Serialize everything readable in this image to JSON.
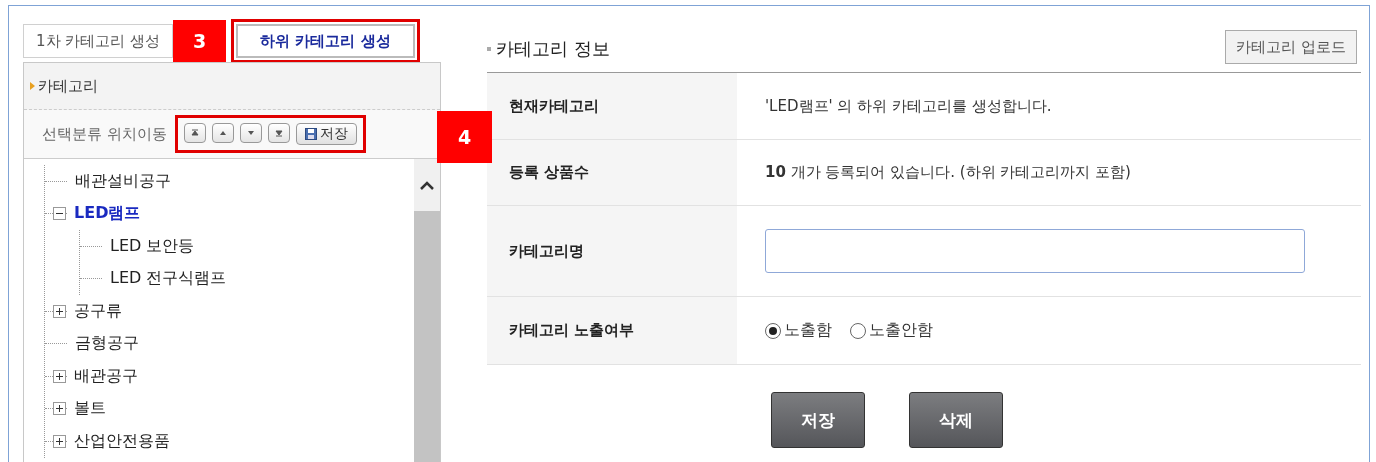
{
  "tabs": [
    {
      "label": "1차 카테고리 생성",
      "selected": false
    },
    {
      "label": "하위 카테고리 생성",
      "selected": true,
      "badge": "3"
    }
  ],
  "category_panel": {
    "title": "카테고리",
    "move_label": "선택분류 위치이동",
    "move_badge": "4",
    "move_buttons": [
      {
        "kind": "top"
      },
      {
        "kind": "up"
      },
      {
        "kind": "down"
      },
      {
        "kind": "bottom"
      }
    ],
    "save_button": "저장",
    "tree": [
      {
        "label": "배관설비공구",
        "selected": false
      },
      {
        "label": "LED램프",
        "selected": true,
        "expanded": true,
        "children": [
          {
            "label": "LED 보안등",
            "selected": false
          },
          {
            "label": "LED 전구식램프",
            "selected": false
          }
        ]
      },
      {
        "label": "공구류",
        "selected": false,
        "expanded": false
      },
      {
        "label": "금형공구",
        "selected": false
      },
      {
        "label": "배관공구",
        "selected": false,
        "expanded": false
      },
      {
        "label": "볼트",
        "selected": false,
        "expanded": false
      },
      {
        "label": "산업안전용품",
        "selected": false,
        "expanded": false
      }
    ]
  },
  "info_panel": {
    "title": "카테고리 정보",
    "upload_button": "카테고리 업로드",
    "rows": [
      {
        "label": "현재카테고리",
        "kind": "text",
        "value": "'LED램프' 의 하위 카테고리를 생성합니다."
      },
      {
        "label": "등록 상품수",
        "kind": "text",
        "value": "**10** 개가 등록되어 있습니다. (하위 카테고리까지 포함)"
      },
      {
        "label": "카테고리명",
        "kind": "input"
      },
      {
        "label": "카테고리 노출여부",
        "kind": "radio",
        "options": [
          {
            "label": "노출함",
            "selected": true
          },
          {
            "label": "노출안함",
            "selected": false
          }
        ]
      }
    ],
    "buttons": [
      "저장",
      "삭제"
    ]
  }
}
